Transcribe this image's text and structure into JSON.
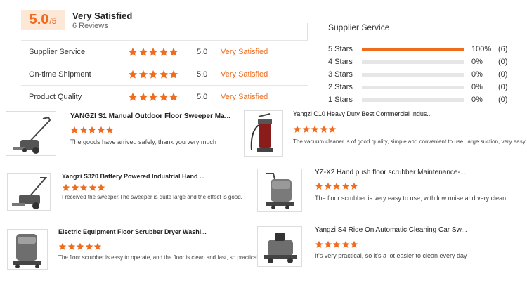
{
  "summary": {
    "score": "5.0",
    "score_suffix": "/5",
    "title": "Very Satisfied",
    "reviews_count": "6 Reviews"
  },
  "ratings": [
    {
      "label": "Supplier Service",
      "value": "5.0",
      "text": "Very Satisfied",
      "stars": 5
    },
    {
      "label": "On-time Shipment",
      "value": "5.0",
      "text": "Very Satisfied",
      "stars": 5
    },
    {
      "label": "Product Quality",
      "value": "5.0",
      "text": "Very Satisfied",
      "stars": 5
    }
  ],
  "distribution": {
    "title": "Supplier Service",
    "rows": [
      {
        "label": "5 Stars",
        "fraction": 1.0,
        "pct": "100%",
        "count": "(6)"
      },
      {
        "label": "4 Stars",
        "fraction": 0.0,
        "pct": "0%",
        "count": "(0)"
      },
      {
        "label": "3 Stars",
        "fraction": 0.0,
        "pct": "0%",
        "count": "(0)"
      },
      {
        "label": "2 Stars",
        "fraction": 0.0,
        "pct": "0%",
        "count": "(0)"
      },
      {
        "label": "1 Stars",
        "fraction": 0.0,
        "pct": "0%",
        "count": "(0)"
      }
    ]
  },
  "reviews": [
    {
      "title": "YANGZI S1 Manual Outdoor Floor Sweeper Ma...",
      "stars": 5,
      "text": "The goods have arrived safely, thank you very much",
      "product_icon": "manual-sweeper-icon"
    },
    {
      "title": "Yangzi C10 Heavy Duty Best Commercial Indus...",
      "stars": 5,
      "text": "The vacuum cleaner is of good quality, simple and convenient to use, large suction, very easy to use",
      "product_icon": "vacuum-cleaner-icon"
    },
    {
      "title": "Yangzi S320 Battery Powered Industrial Hand ...",
      "stars": 5,
      "text": "I received the sweeper.The sweeper is quite large and the effect is good.",
      "product_icon": "battery-sweeper-icon"
    },
    {
      "title": "YZ-X2 Hand push floor scrubber Maintenance-...",
      "stars": 5,
      "text": "The floor scrubber is very easy to use, with low noise and very clean",
      "product_icon": "floor-scrubber-icon"
    },
    {
      "title": "Electric Equipment Floor Scrubber Dryer Washi...",
      "stars": 5,
      "text": "The floor scrubber is easy to operate, and the floor is clean and fast, so practical!",
      "product_icon": "scrubber-dryer-icon"
    },
    {
      "title": "Yangzi S4 Ride On Automatic Cleaning Car Sw...",
      "stars": 5,
      "text": "It's very practical, so it's a lot easier to clean every day",
      "product_icon": "ride-on-sweeper-icon"
    }
  ],
  "colors": {
    "accent": "#f06b1c",
    "accent_light": "#fde8d8",
    "bar_bg": "#e6e6e6"
  }
}
